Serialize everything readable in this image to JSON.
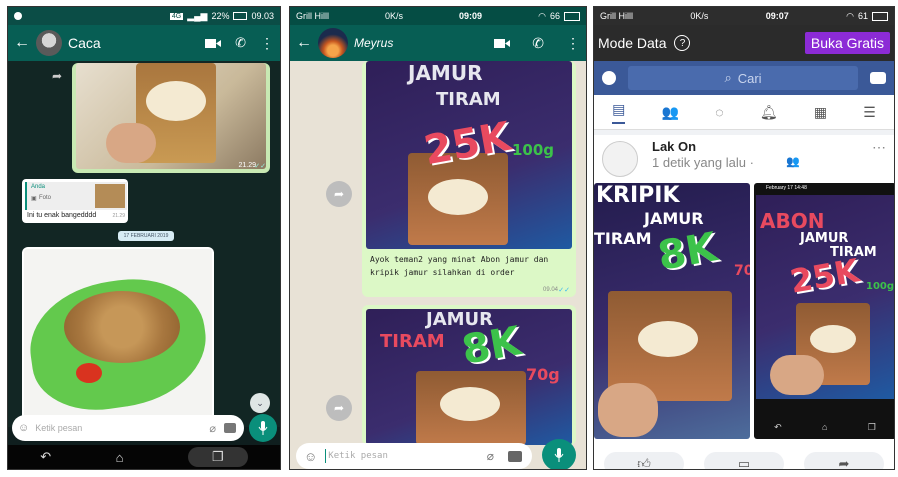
{
  "panel1": {
    "status_time": "09.03",
    "status_battery": "22%",
    "status_net": "4G",
    "contact_name": "Caca",
    "image_time": "21.29",
    "reply_sender": "Anda",
    "reply_type": "Foto",
    "message_text": "Ini tu enak bangedddd",
    "message_time": "21.29",
    "date_chip": "17 FEBRUARI 2019",
    "input_placeholder": "Ketik pesan"
  },
  "panel2": {
    "status_carrier": "Grill Hilll",
    "status_speed": "0K/s",
    "status_time": "09:09",
    "status_battery": "66",
    "contact_name": "Meyrus",
    "poster1_line1": "JAMUR",
    "poster1_line2": "TIRAM",
    "poster1_price": "25K",
    "poster1_weight": "100g",
    "caption": "Ayok teman2 yang minat Abon jamur dan kripik jamur silahkan di order",
    "caption_time": "09.04",
    "poster2_line1": "JAMUR",
    "poster2_line2": "TIRAM",
    "poster2_price": "8K",
    "poster2_weight": "70g",
    "input_placeholder": "Ketik pesan"
  },
  "panel3": {
    "status_carrier": "Grill Hilll",
    "status_speed": "0K/s",
    "status_time": "09:07",
    "status_battery": "61",
    "mode_data": "Mode Data",
    "buka_gratis": "Buka Gratis",
    "search_placeholder": "Cari",
    "author": "Lak On",
    "post_time": "1 detik yang lalu ·",
    "img1_line1": "KRIPIK",
    "img1_line2": "JAMUR",
    "img1_line3": "TIRAM",
    "img1_price": "8K",
    "img1_weight": "70",
    "img2_date": "February 17  14:48",
    "img2_line1": "ABON",
    "img2_line2": "JAMUR",
    "img2_line3": "TIRAM",
    "img2_price": "25K",
    "img2_weight": "100g"
  },
  "colors": {
    "wa_green_dark": "#075e54",
    "wa_teal": "#0a8f7b",
    "wa_bubble": "#dcf8c6",
    "fb_blue": "#3b5998",
    "fb_purple": "#8c2bd6",
    "poster_red": "#e84a5f",
    "poster_green": "#3cc24a"
  }
}
